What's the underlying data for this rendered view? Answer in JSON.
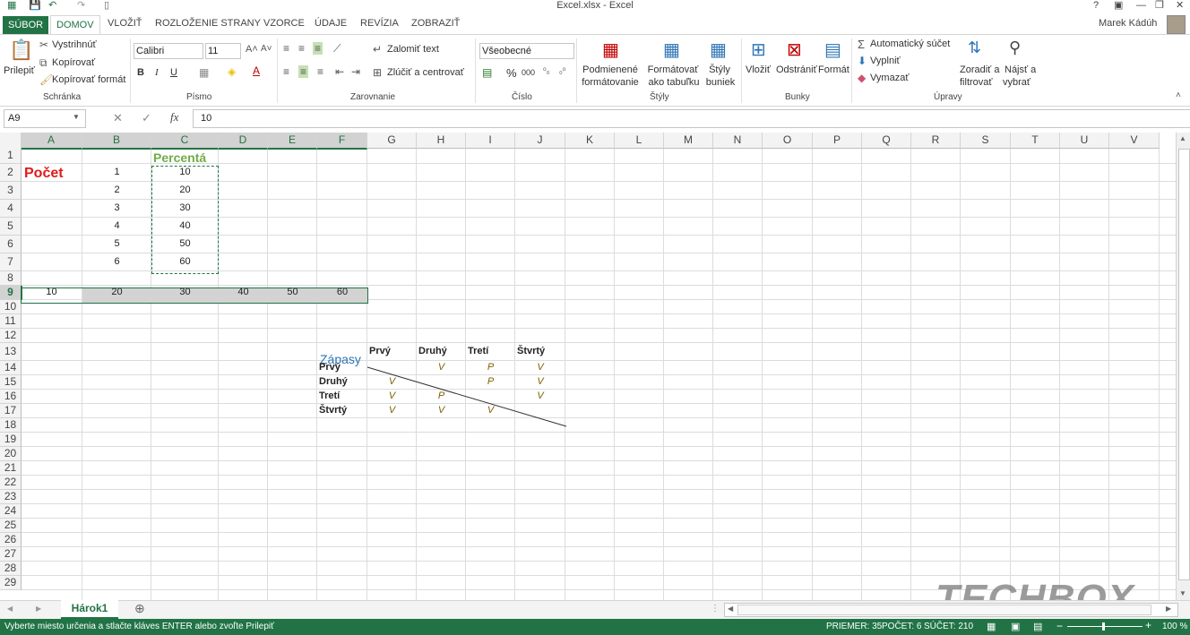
{
  "window": {
    "title": "Excel.xlsx - Excel",
    "user": "Marek Kádúh",
    "controls": [
      "?",
      "▢",
      "—",
      "❐",
      "✕"
    ]
  },
  "qat": {
    "save_icon": "save-icon",
    "undo_icon": "undo-icon",
    "redo_icon": "redo-icon"
  },
  "tabs": [
    {
      "label": "SÚBOR"
    },
    {
      "label": "DOMOV"
    },
    {
      "label": "VLOŽIŤ"
    },
    {
      "label": "ROZLOŽENIE STRANY"
    },
    {
      "label": "VZORCE"
    },
    {
      "label": "ÚDAJE"
    },
    {
      "label": "REVÍZIA"
    },
    {
      "label": "ZOBRAZIŤ"
    }
  ],
  "ribbon": {
    "clipboard": {
      "label": "Schránka",
      "paste": "Prilepiť",
      "cut": "Vystrihnúť",
      "copy": "Kopírovať",
      "format_painter": "Kopírovať formát"
    },
    "font": {
      "label": "Písmo",
      "name": "Calibri",
      "size": "11",
      "bold": "B",
      "italic": "I",
      "underline": "U"
    },
    "alignment": {
      "label": "Zarovnanie",
      "wrap": "Zalomiť text",
      "merge": "Zlúčiť a centrovať"
    },
    "number": {
      "label": "Číslo",
      "format": "Všeobecné",
      "percent": "%",
      "thousands": "000"
    },
    "styles": {
      "label": "Štýly",
      "conditional": [
        "Podmienené",
        "formátovanie"
      ],
      "as_table": [
        "Formátovať",
        "ako tabuľku"
      ],
      "cell_styles": [
        "Štýly",
        "buniek"
      ]
    },
    "cells": {
      "label": "Bunky",
      "insert": "Vložiť",
      "delete": "Odstrániť",
      "format": "Formát"
    },
    "editing": {
      "label": "Úpravy",
      "autosum": "Automatický súčet",
      "fill": "Vyplniť",
      "clear": "Vymazať",
      "sort": [
        "Zoradiť a",
        "filtrovať"
      ],
      "find": [
        "Nájsť a",
        "vybrať"
      ]
    }
  },
  "formula_bar": {
    "name_box": "A9",
    "fx": "fx",
    "value": "10"
  },
  "columns": [
    "A",
    "B",
    "C",
    "D",
    "E",
    "F",
    "G",
    "H",
    "I",
    "J",
    "K",
    "L",
    "M",
    "N",
    "O",
    "P",
    "Q",
    "R",
    "S",
    "T",
    "U",
    "V"
  ],
  "rows": [
    "1",
    "2",
    "3",
    "4",
    "5",
    "6",
    "7",
    "8",
    "9",
    "10",
    "11",
    "12",
    "13",
    "14",
    "15",
    "16",
    "17",
    "18",
    "19",
    "20",
    "21",
    "22",
    "23",
    "24",
    "25",
    "26",
    "27",
    "28",
    "29"
  ],
  "cells": {
    "pocet": "Počet",
    "percenta": "Percentá",
    "b_values": [
      "1",
      "2",
      "3",
      "4",
      "5",
      "6"
    ],
    "c_values": [
      "10",
      "20",
      "30",
      "40",
      "50",
      "60"
    ],
    "row9": [
      "10",
      "20",
      "30",
      "40",
      "50",
      "60"
    ],
    "zapasy": "Zápasy",
    "teams": [
      "Prvý",
      "Druhý",
      "Tretí",
      "Štvrtý"
    ],
    "matrix": [
      [
        "",
        "V",
        "P",
        "V"
      ],
      [
        "V",
        "",
        "P",
        "V"
      ],
      [
        "V",
        "P",
        "",
        "V"
      ],
      [
        "V",
        "V",
        "V",
        ""
      ]
    ]
  },
  "sheet": {
    "tab": "Hárok1",
    "add": "⊕"
  },
  "status": {
    "message": "Vyberte miesto určenia a stlačte kláves ENTER alebo zvoľte Prilepiť",
    "average": "PRIEMER: 35",
    "count": "POČET: 6",
    "sum": "SÚČET: 210",
    "zoom": "100 %"
  },
  "watermark": "TECHBOX",
  "colors": {
    "excel_green": "#217346",
    "red": "#e01b1b",
    "title_green": "#70ad47",
    "blue": "#2e75b6",
    "italic_brown": "#7f6000"
  }
}
